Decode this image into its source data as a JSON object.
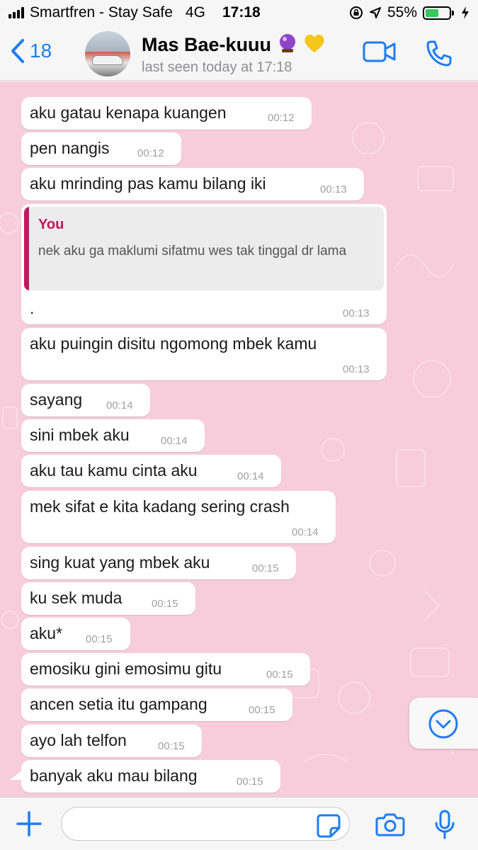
{
  "status_bar": {
    "carrier": "Smartfren - Stay Safe",
    "network": "4G",
    "time": "17:18",
    "battery_percent": "55%",
    "battery_level": 0.55
  },
  "header": {
    "back_count": "18",
    "contact_name": "Mas Bae-kuuu",
    "contact_emojis": [
      "crystal-ball",
      "yellow-heart"
    ],
    "last_seen": "last seen today at 17:18"
  },
  "colors": {
    "accent": "#1e7cf2",
    "chat_background": "#f7cddb",
    "quote_author": "#c2185b"
  },
  "messages": [
    {
      "text": "aku gatau kenapa kuangen",
      "time": "00:12"
    },
    {
      "text": "pen nangis",
      "time": "00:12"
    },
    {
      "text": "aku mrinding pas kamu bilang iki",
      "time": "00:13"
    },
    {
      "quote_author": "You",
      "quote_text": "nek aku ga maklumi sifatmu wes tak tinggal dr lama",
      "text": ".",
      "time": "00:13"
    },
    {
      "text": "aku puingin disitu ngomong mbek kamu",
      "time": "00:13"
    },
    {
      "text": "sayang",
      "time": "00:14"
    },
    {
      "text": "sini mbek aku",
      "time": "00:14"
    },
    {
      "text": "aku tau kamu cinta aku",
      "time": "00:14"
    },
    {
      "text": "mek sifat e kita kadang sering crash",
      "time": "00:14"
    },
    {
      "text": "sing kuat yang mbek aku",
      "time": "00:15"
    },
    {
      "text": "ku sek muda",
      "time": "00:15"
    },
    {
      "text": "aku*",
      "time": "00:15"
    },
    {
      "text": "emosiku gini emosimu gitu",
      "time": "00:15"
    },
    {
      "text": "ancen setia itu gampang",
      "time": "00:15"
    },
    {
      "text": "ayo lah telfon",
      "time": "00:15"
    },
    {
      "text": "banyak aku mau bilang",
      "time": "00:15"
    }
  ],
  "input": {
    "value": "",
    "placeholder": ""
  }
}
